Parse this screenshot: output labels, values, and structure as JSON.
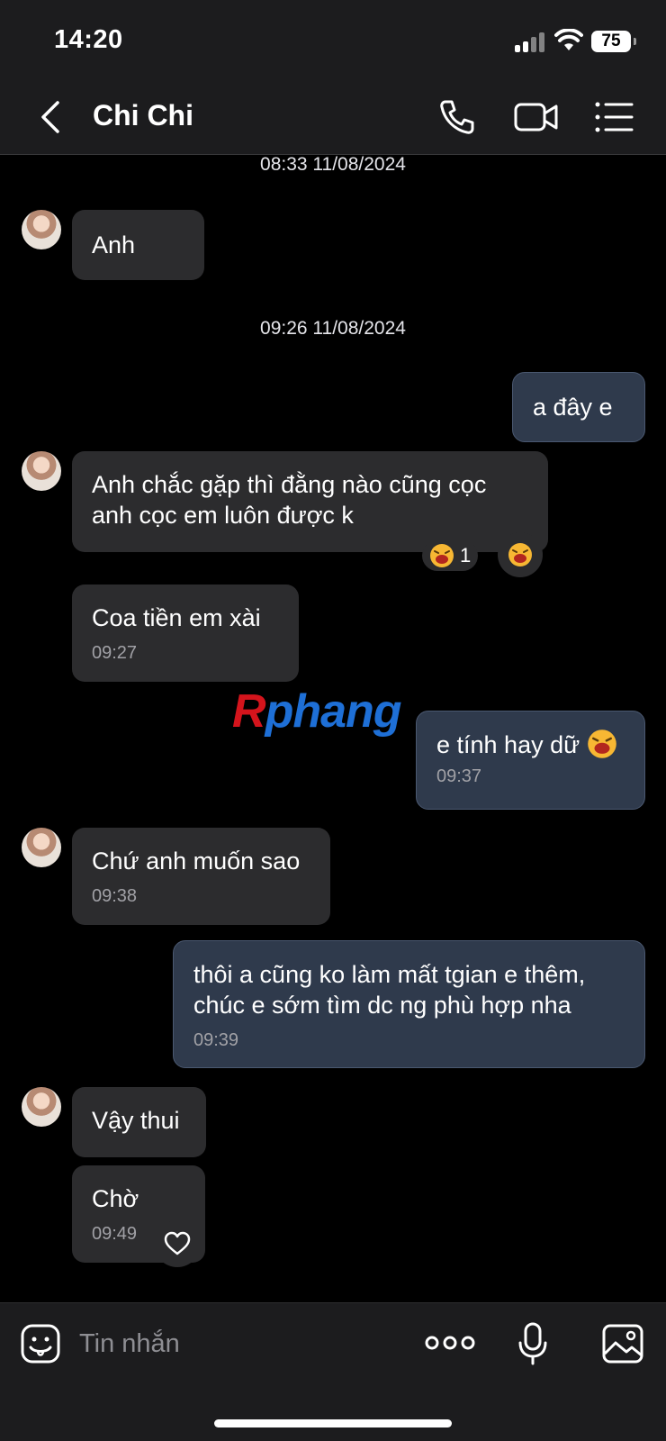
{
  "status_bar": {
    "time": "14:20",
    "battery": "75"
  },
  "header": {
    "contact_name": "Chi Chi"
  },
  "chat": {
    "timestamps": [
      "08:33 11/08/2024",
      "09:26 11/08/2024"
    ],
    "messages": [
      {
        "from": "them",
        "text": "Anh"
      },
      {
        "from": "me",
        "text": "a đây e"
      },
      {
        "from": "them",
        "text": "Anh chắc gặp thì đằng nào cũng cọc anh cọc em luôn được k",
        "reaction": "laughing-face",
        "reaction_count": "1"
      },
      {
        "from": "them",
        "text": "Coa tiền em xài",
        "time": "09:27"
      },
      {
        "from": "me",
        "text": "e tính hay dữ",
        "emoji": "laughing-face",
        "time": "09:37"
      },
      {
        "from": "them",
        "text": "Chứ anh muốn sao",
        "time": "09:38"
      },
      {
        "from": "me",
        "text": "thôi a cũng ko làm mất tgian e thêm, chúc e sớm tìm dc ng phù hợp nha",
        "time": "09:39"
      },
      {
        "from": "them",
        "text": "Vậy thui"
      },
      {
        "from": "them",
        "text": "Chờ",
        "time": "09:49"
      }
    ]
  },
  "watermark": {
    "r": "R",
    "rest": "phang"
  },
  "input": {
    "placeholder": "Tin nhắn"
  },
  "colors": {
    "sent_bubble": "#2f3a4c",
    "received_bubble": "#2c2c2e",
    "background": "#000000",
    "bar": "#1c1c1e"
  }
}
